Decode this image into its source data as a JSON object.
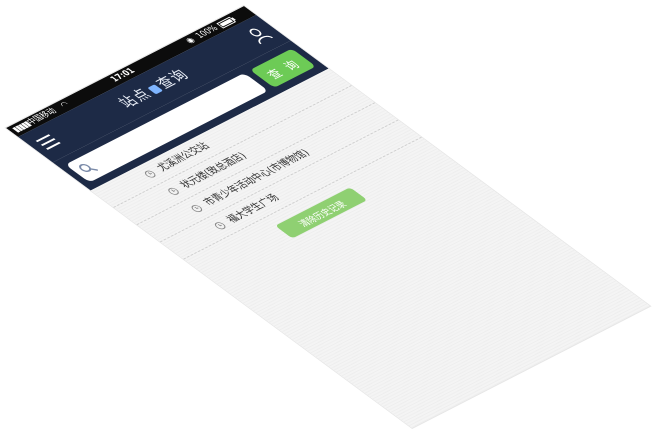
{
  "status_bar": {
    "carrier": "中国移动",
    "time": "17:01",
    "battery": "100%"
  },
  "header": {
    "title_left": "站点",
    "title_right": "查询"
  },
  "search": {
    "placeholder": "",
    "value": "",
    "button_label": "查 询"
  },
  "history": {
    "items": [
      {
        "label": "尤溪洲公交站"
      },
      {
        "label": "状元楼(致总酒店)"
      },
      {
        "label": "市青少年活动中心(市博物馆)"
      },
      {
        "label": "福大学生广场"
      }
    ],
    "clear_label": "清除历史记录"
  },
  "colors": {
    "navbar": "#1d2a46",
    "accent_green": "#6dcb56",
    "clear_green": "#8fd072",
    "background": "#f4f4f4"
  },
  "icons": {
    "menu": "menu-icon",
    "user": "user-icon",
    "search": "search-icon",
    "history": "clock-icon"
  }
}
